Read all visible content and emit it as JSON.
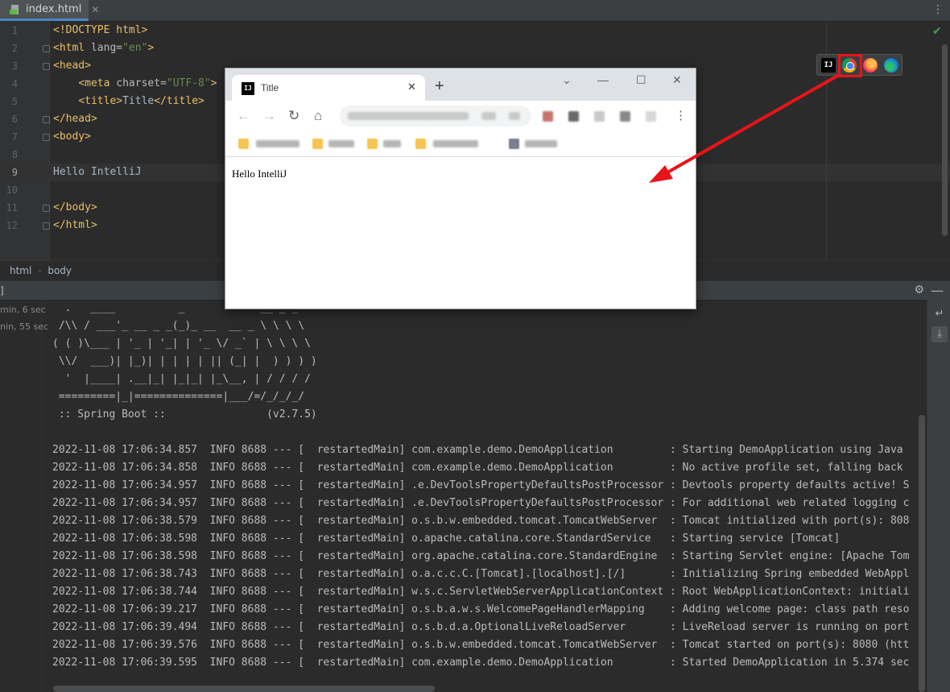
{
  "tab": {
    "filename": "index.html"
  },
  "editor": {
    "lines": [
      {
        "num": "1",
        "parts": [
          [
            "tag",
            "<!DOCTYPE html>"
          ]
        ]
      },
      {
        "num": "2",
        "parts": [
          [
            "tag",
            "<html "
          ],
          [
            "attr",
            "lang="
          ],
          [
            "str",
            "\"en\""
          ],
          [
            "tag",
            ">"
          ]
        ]
      },
      {
        "num": "3",
        "parts": [
          [
            "tag",
            "<head>"
          ]
        ]
      },
      {
        "num": "4",
        "parts": [
          [
            "txt",
            "    "
          ],
          [
            "tag",
            "<meta "
          ],
          [
            "attr",
            "charset="
          ],
          [
            "str",
            "\"UTF-8\""
          ],
          [
            "tag",
            ">"
          ]
        ]
      },
      {
        "num": "5",
        "parts": [
          [
            "txt",
            "    "
          ],
          [
            "tag",
            "<title>"
          ],
          [
            "txt",
            "Title"
          ],
          [
            "tag",
            "</title>"
          ]
        ]
      },
      {
        "num": "6",
        "parts": [
          [
            "tag",
            "</head>"
          ]
        ]
      },
      {
        "num": "7",
        "parts": [
          [
            "tag",
            "<body>"
          ]
        ]
      },
      {
        "num": "8",
        "parts": []
      },
      {
        "num": "9",
        "parts": [
          [
            "txt",
            "Hello IntelliJ"
          ]
        ]
      },
      {
        "num": "10",
        "parts": []
      },
      {
        "num": "11",
        "parts": [
          [
            "tag",
            "</body>"
          ]
        ]
      },
      {
        "num": "12",
        "parts": [
          [
            "tag",
            "</html>"
          ]
        ]
      }
    ],
    "current_line": "9",
    "browser_icons": [
      "intellij-icon",
      "chrome-icon",
      "firefox-icon",
      "edge-icon"
    ]
  },
  "breadcrumb": {
    "items": [
      "html",
      "body"
    ]
  },
  "run": {
    "history": [
      "min, 6 sec",
      "nin, 55 sec"
    ],
    "banner": [
      "  .   ____          _            __ _ _",
      " /\\\\ / ___'_ __ _ _(_)_ __  __ _ \\ \\ \\ \\",
      "( ( )\\___ | '_ | '_| | '_ \\/ _` | \\ \\ \\ \\",
      " \\\\/  ___)| |_)| | | | | || (_| |  ) ) ) )",
      "  '  |____| .__|_| |_|_| |_\\__, | / / / /",
      " =========|_|==============|___/=/_/_/_/",
      " :: Spring Boot ::                (v2.7.5)"
    ],
    "log": [
      "2022-11-08 17:06:34.857  INFO 8688 --- [  restartedMain] com.example.demo.DemoApplication         : Starting DemoApplication using Java",
      "2022-11-08 17:06:34.858  INFO 8688 --- [  restartedMain] com.example.demo.DemoApplication         : No active profile set, falling back",
      "2022-11-08 17:06:34.957  INFO 8688 --- [  restartedMain] .e.DevToolsPropertyDefaultsPostProcessor : Devtools property defaults active! S",
      "2022-11-08 17:06:34.957  INFO 8688 --- [  restartedMain] .e.DevToolsPropertyDefaultsPostProcessor : For additional web related logging c",
      "2022-11-08 17:06:38.579  INFO 8688 --- [  restartedMain] o.s.b.w.embedded.tomcat.TomcatWebServer  : Tomcat initialized with port(s): 808",
      "2022-11-08 17:06:38.598  INFO 8688 --- [  restartedMain] o.apache.catalina.core.StandardService   : Starting service [Tomcat]",
      "2022-11-08 17:06:38.598  INFO 8688 --- [  restartedMain] org.apache.catalina.core.StandardEngine  : Starting Servlet engine: [Apache Tom",
      "2022-11-08 17:06:38.743  INFO 8688 --- [  restartedMain] o.a.c.c.C.[Tomcat].[localhost].[/]       : Initializing Spring embedded WebAppl",
      "2022-11-08 17:06:38.744  INFO 8688 --- [  restartedMain] w.s.c.ServletWebServerApplicationContext : Root WebApplicationContext: initiali",
      "2022-11-08 17:06:39.217  INFO 8688 --- [  restartedMain] o.s.b.a.w.s.WelcomePageHandlerMapping    : Adding welcome page: class path reso",
      "2022-11-08 17:06:39.494  INFO 8688 --- [  restartedMain] o.s.b.d.a.OptionalLiveReloadServer       : LiveReload server is running on port",
      "2022-11-08 17:06:39.576  INFO 8688 --- [  restartedMain] o.s.b.w.embedded.tomcat.TomcatWebServer  : Tomcat started on port(s): 8080 (htt",
      "2022-11-08 17:06:39.595  INFO 8688 --- [  restartedMain] com.example.demo.DemoApplication         : Started DemoApplication in 5.374 sec"
    ]
  },
  "browser": {
    "tab_title": "Title",
    "page_text": "Hello IntelliJ",
    "new_tab_label": "+",
    "close_label": "✕"
  },
  "colors": {
    "highlight": "#e8141a",
    "arrow": "#e8141a",
    "xml_tag": "#e8bf6a",
    "xml_string": "#6a8759"
  }
}
